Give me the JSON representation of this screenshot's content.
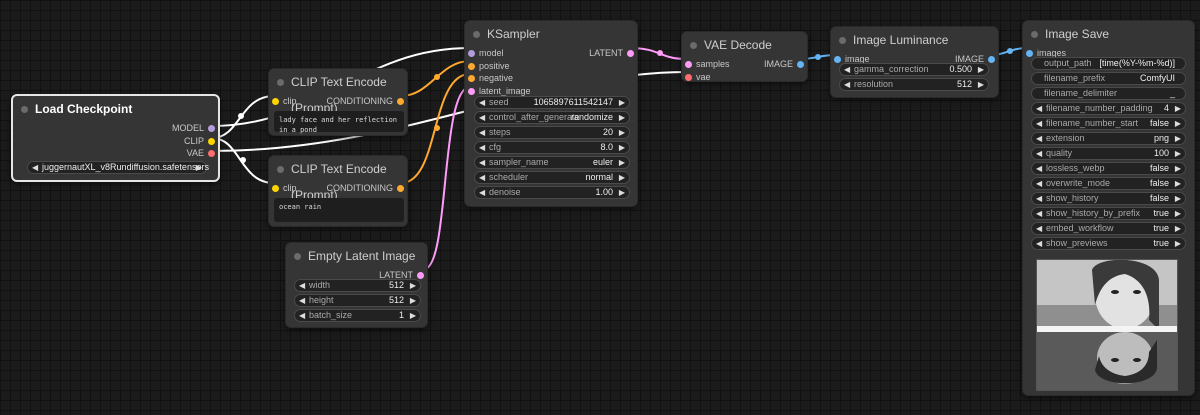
{
  "colors": {
    "model": "#b39ddb",
    "clip": "#ffd500",
    "vae": "#ff6e6e",
    "conditioning": "#ffa931",
    "latent": "#ff9cf9",
    "image": "#64b5f6"
  },
  "load_checkpoint": {
    "title": "Load Checkpoint",
    "outputs": [
      "MODEL",
      "CLIP",
      "VAE"
    ],
    "ckpt_name": "juggernautXL_v8Rundiffusion.safetensors"
  },
  "clip_text_1": {
    "title": "CLIP Text Encode (Prompt)",
    "input": "clip",
    "output": "CONDITIONING",
    "text": "lady face and her reflection in a pond"
  },
  "clip_text_2": {
    "title": "CLIP Text Encode (Prompt)",
    "input": "clip",
    "output": "CONDITIONING",
    "text": "ocean rain"
  },
  "empty_latent": {
    "title": "Empty Latent Image",
    "output": "LATENT",
    "widgets": [
      {
        "label": "width",
        "value": "512"
      },
      {
        "label": "height",
        "value": "512"
      },
      {
        "label": "batch_size",
        "value": "1"
      }
    ]
  },
  "ksampler": {
    "title": "KSampler",
    "inputs": [
      "model",
      "positive",
      "negative",
      "latent_image"
    ],
    "output": "LATENT",
    "widgets": [
      {
        "label": "seed",
        "value": "1065897611542147"
      },
      {
        "label": "control_after_generate",
        "value": "randomize"
      },
      {
        "label": "steps",
        "value": "20"
      },
      {
        "label": "cfg",
        "value": "8.0"
      },
      {
        "label": "sampler_name",
        "value": "euler"
      },
      {
        "label": "scheduler",
        "value": "normal"
      },
      {
        "label": "denoise",
        "value": "1.00"
      }
    ]
  },
  "vae_decode": {
    "title": "VAE Decode",
    "inputs": [
      "samples",
      "vae"
    ],
    "output": "IMAGE"
  },
  "image_luminance": {
    "title": "Image Luminance",
    "input": "image",
    "output": "IMAGE",
    "widgets": [
      {
        "label": "gamma_correction",
        "value": "0.500"
      },
      {
        "label": "resolution",
        "value": "512"
      }
    ]
  },
  "image_save": {
    "title": "Image Save",
    "input": "images",
    "text_widgets": [
      {
        "label": "output_path",
        "value": "[time(%Y-%m-%d)]"
      },
      {
        "label": "filename_prefix",
        "value": "ComfyUI"
      },
      {
        "label": "filename_delimiter",
        "value": "_"
      }
    ],
    "widgets": [
      {
        "label": "filename_number_padding",
        "value": "4"
      },
      {
        "label": "filename_number_start",
        "value": "false"
      },
      {
        "label": "extension",
        "value": "png"
      },
      {
        "label": "quality",
        "value": "100"
      },
      {
        "label": "lossless_webp",
        "value": "false"
      },
      {
        "label": "overwrite_mode",
        "value": "false"
      },
      {
        "label": "show_history",
        "value": "false"
      },
      {
        "label": "show_history_by_prefix",
        "value": "true"
      },
      {
        "label": "embed_workflow",
        "value": "true"
      },
      {
        "label": "show_previews",
        "value": "true"
      }
    ]
  }
}
